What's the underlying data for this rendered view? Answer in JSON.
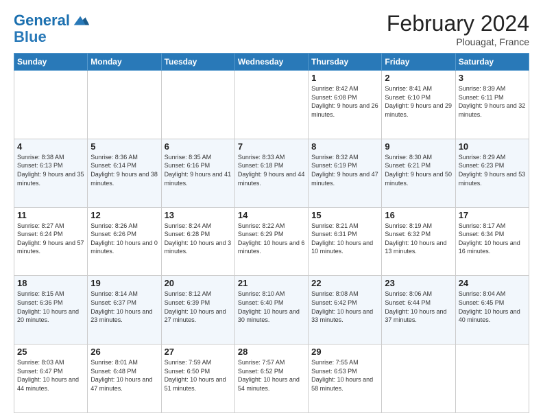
{
  "logo": {
    "line1": "General",
    "line2": "Blue"
  },
  "title": "February 2024",
  "location": "Plouagat, France",
  "days_of_week": [
    "Sunday",
    "Monday",
    "Tuesday",
    "Wednesday",
    "Thursday",
    "Friday",
    "Saturday"
  ],
  "weeks": [
    [
      {
        "day": "",
        "info": ""
      },
      {
        "day": "",
        "info": ""
      },
      {
        "day": "",
        "info": ""
      },
      {
        "day": "",
        "info": ""
      },
      {
        "day": "1",
        "info": "Sunrise: 8:42 AM\nSunset: 6:08 PM\nDaylight: 9 hours and 26 minutes."
      },
      {
        "day": "2",
        "info": "Sunrise: 8:41 AM\nSunset: 6:10 PM\nDaylight: 9 hours and 29 minutes."
      },
      {
        "day": "3",
        "info": "Sunrise: 8:39 AM\nSunset: 6:11 PM\nDaylight: 9 hours and 32 minutes."
      }
    ],
    [
      {
        "day": "4",
        "info": "Sunrise: 8:38 AM\nSunset: 6:13 PM\nDaylight: 9 hours and 35 minutes."
      },
      {
        "day": "5",
        "info": "Sunrise: 8:36 AM\nSunset: 6:14 PM\nDaylight: 9 hours and 38 minutes."
      },
      {
        "day": "6",
        "info": "Sunrise: 8:35 AM\nSunset: 6:16 PM\nDaylight: 9 hours and 41 minutes."
      },
      {
        "day": "7",
        "info": "Sunrise: 8:33 AM\nSunset: 6:18 PM\nDaylight: 9 hours and 44 minutes."
      },
      {
        "day": "8",
        "info": "Sunrise: 8:32 AM\nSunset: 6:19 PM\nDaylight: 9 hours and 47 minutes."
      },
      {
        "day": "9",
        "info": "Sunrise: 8:30 AM\nSunset: 6:21 PM\nDaylight: 9 hours and 50 minutes."
      },
      {
        "day": "10",
        "info": "Sunrise: 8:29 AM\nSunset: 6:23 PM\nDaylight: 9 hours and 53 minutes."
      }
    ],
    [
      {
        "day": "11",
        "info": "Sunrise: 8:27 AM\nSunset: 6:24 PM\nDaylight: 9 hours and 57 minutes."
      },
      {
        "day": "12",
        "info": "Sunrise: 8:26 AM\nSunset: 6:26 PM\nDaylight: 10 hours and 0 minutes."
      },
      {
        "day": "13",
        "info": "Sunrise: 8:24 AM\nSunset: 6:28 PM\nDaylight: 10 hours and 3 minutes."
      },
      {
        "day": "14",
        "info": "Sunrise: 8:22 AM\nSunset: 6:29 PM\nDaylight: 10 hours and 6 minutes."
      },
      {
        "day": "15",
        "info": "Sunrise: 8:21 AM\nSunset: 6:31 PM\nDaylight: 10 hours and 10 minutes."
      },
      {
        "day": "16",
        "info": "Sunrise: 8:19 AM\nSunset: 6:32 PM\nDaylight: 10 hours and 13 minutes."
      },
      {
        "day": "17",
        "info": "Sunrise: 8:17 AM\nSunset: 6:34 PM\nDaylight: 10 hours and 16 minutes."
      }
    ],
    [
      {
        "day": "18",
        "info": "Sunrise: 8:15 AM\nSunset: 6:36 PM\nDaylight: 10 hours and 20 minutes."
      },
      {
        "day": "19",
        "info": "Sunrise: 8:14 AM\nSunset: 6:37 PM\nDaylight: 10 hours and 23 minutes."
      },
      {
        "day": "20",
        "info": "Sunrise: 8:12 AM\nSunset: 6:39 PM\nDaylight: 10 hours and 27 minutes."
      },
      {
        "day": "21",
        "info": "Sunrise: 8:10 AM\nSunset: 6:40 PM\nDaylight: 10 hours and 30 minutes."
      },
      {
        "day": "22",
        "info": "Sunrise: 8:08 AM\nSunset: 6:42 PM\nDaylight: 10 hours and 33 minutes."
      },
      {
        "day": "23",
        "info": "Sunrise: 8:06 AM\nSunset: 6:44 PM\nDaylight: 10 hours and 37 minutes."
      },
      {
        "day": "24",
        "info": "Sunrise: 8:04 AM\nSunset: 6:45 PM\nDaylight: 10 hours and 40 minutes."
      }
    ],
    [
      {
        "day": "25",
        "info": "Sunrise: 8:03 AM\nSunset: 6:47 PM\nDaylight: 10 hours and 44 minutes."
      },
      {
        "day": "26",
        "info": "Sunrise: 8:01 AM\nSunset: 6:48 PM\nDaylight: 10 hours and 47 minutes."
      },
      {
        "day": "27",
        "info": "Sunrise: 7:59 AM\nSunset: 6:50 PM\nDaylight: 10 hours and 51 minutes."
      },
      {
        "day": "28",
        "info": "Sunrise: 7:57 AM\nSunset: 6:52 PM\nDaylight: 10 hours and 54 minutes."
      },
      {
        "day": "29",
        "info": "Sunrise: 7:55 AM\nSunset: 6:53 PM\nDaylight: 10 hours and 58 minutes."
      },
      {
        "day": "",
        "info": ""
      },
      {
        "day": "",
        "info": ""
      }
    ]
  ]
}
